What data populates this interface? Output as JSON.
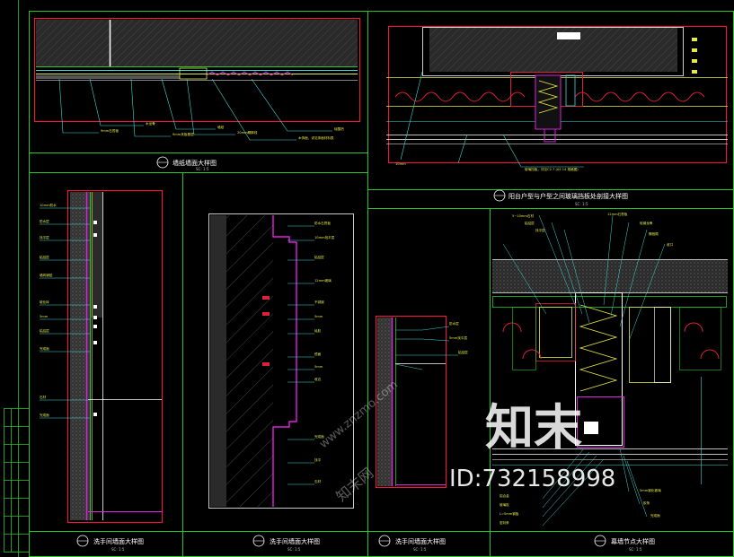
{
  "titles": {
    "t1": "墙纸墙面大样图",
    "t2": "阳台户型与户型之间玻璃挡板处剖接大样图",
    "t3": "洗手间墙面大样图",
    "t4": "洗手间墙面大样图",
    "t5": "洗手间墙面大样图",
    "t6": "幕墙节点大样图"
  },
  "scales": {
    "s1": "SC: 1:5",
    "s2": "SC: 1:5",
    "s3": "SC: 1:5",
    "s4": "SC: 1:5",
    "s5": "SC: 1:5",
    "s6": "SC: 1:5"
  },
  "watermark": {
    "logo_text": "知末",
    "id_text": "ID:732158998",
    "site_text": "www.znzmo.com",
    "small_text": "知末网"
  },
  "colors": {
    "background": "#000000",
    "frame": "#26c626",
    "detail_border": "#e0203a",
    "leader": "#3fd6d6",
    "note_text": "#e8e84a",
    "magenta": "#e020e0"
  }
}
